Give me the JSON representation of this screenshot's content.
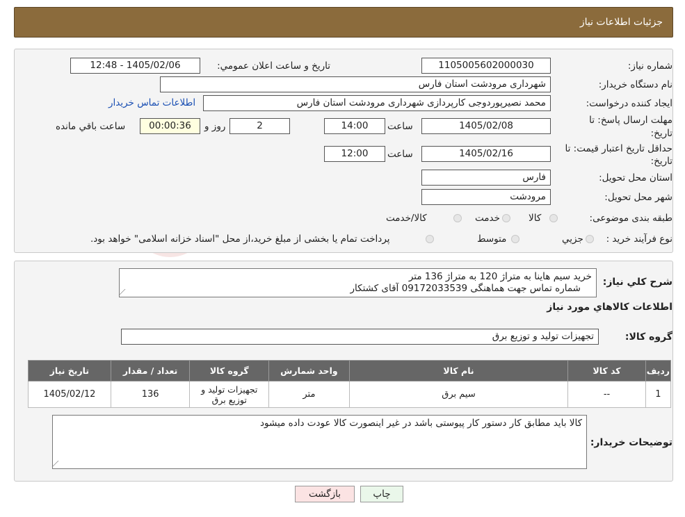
{
  "header": {
    "title": "جزئیات اطلاعات نیاز"
  },
  "watermark": {
    "text": "AriaTender.neT",
    "color": "#c0302a"
  },
  "need": {
    "number_label": "شماره نیاز:",
    "number": "1105005602000030",
    "announce_label": "تاریخ و ساعت اعلان عمومي:",
    "announce": "1405/02/06 - 12:48",
    "buyer_label": "نام دستگاه خريدار:",
    "buyer": "شهرداری مرودشت استان فارس",
    "creator_label": "ايجاد کننده درخواست:",
    "creator": "محمد نصیرپوردوجی کارپردازی شهرداری مرودشت استان فارس",
    "contact_link": "اطلاعات تماس خريدار",
    "reply_label_1": "مهلت ارسال پاسخ: تا",
    "reply_label_2": "تاریخ:",
    "reply_date": "1405/02/08",
    "time_label": "ساعت",
    "reply_time": "14:00",
    "days": "2",
    "days_label": "روز و",
    "remaining": "00:00:36",
    "remaining_label": "ساعت باقي مانده",
    "validity_label_1": "حداقل تاريخ اعتبار قيمت: تا",
    "validity_label_2": "تاريخ:",
    "validity_date": "1405/02/16",
    "validity_time": "12:00",
    "province_label": "استان محل تحويل:",
    "province": "فارس",
    "city_label": "شهر محل تحويل:",
    "city": "مرودشت",
    "category_label": "طبقه بندی موضوعی:",
    "category_options": [
      "کالا",
      "خدمت",
      "کالا/خدمت"
    ],
    "process_label": "نوع فرآيند خريد :",
    "process_options": [
      "جزيي",
      "متوسط"
    ],
    "process_note": "پرداخت تمام يا بخشی از مبلغ خريد،از محل \"اسناد خزانه اسلامی\" خواهد بود."
  },
  "details": {
    "description_label": "شرح کلي نياز:",
    "description_line1": "خرید سیم هاینا به متراژ 120 به متراژ 136 متر",
    "description_line2": "شماره تماس جهت هماهنگی  09172033539   آقای کشتکار",
    "items_title": "اطلاعات کالاهاي مورد نياز",
    "group_label": "گروه کالا:",
    "group_value": "تجهیزات تولید و توزیع برق",
    "table_headers": [
      "رديف",
      "کد کالا",
      "نام کالا",
      "واحد شمارش",
      "گروه کالا",
      "تعداد / مقدار",
      "تاريخ نياز"
    ],
    "rows": [
      {
        "row": "1",
        "code": "--",
        "name": "سیم برق",
        "unit": "متر",
        "group": "تجهیزات تولید و توزیع برق",
        "qty": "136",
        "date": "1405/02/12"
      }
    ],
    "buyer_notes_label": "توضيحات خريدار:",
    "buyer_notes": "کالا باید مطابق کار دستور کار پیوستی باشد در غیر اینصورت کالا عودت داده میشود"
  },
  "buttons": {
    "print": "چاپ",
    "back": "بازگشت"
  }
}
